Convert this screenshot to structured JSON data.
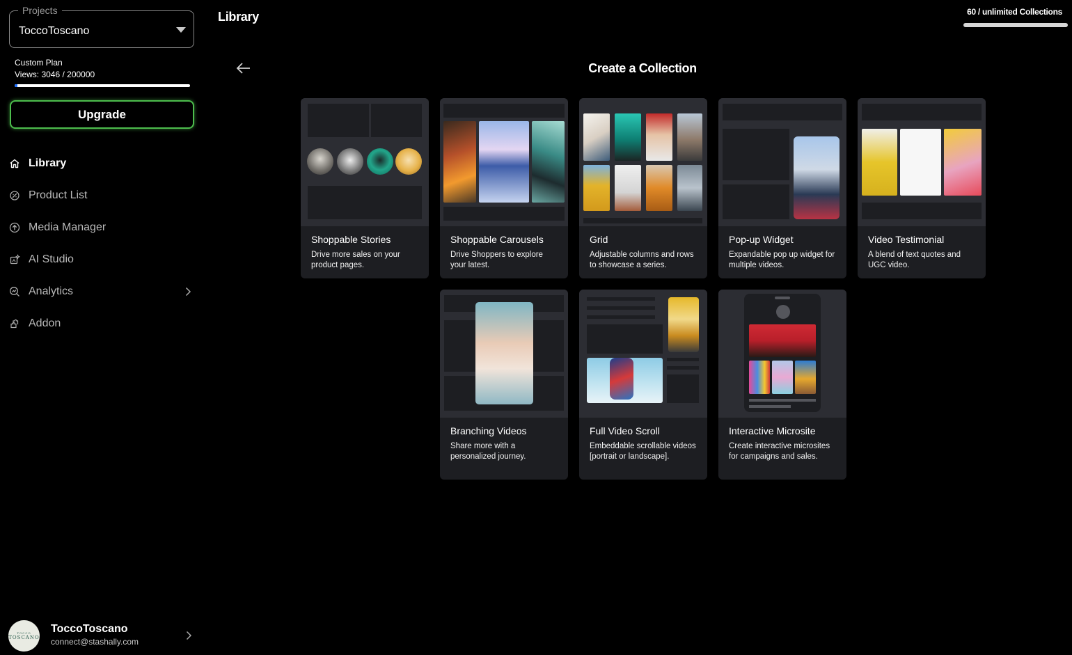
{
  "sidebar": {
    "project_legend": "Projects",
    "project_value": "ToccoToscano",
    "plan_name": "Custom Plan",
    "views_text": "Views: 3046 / 200000",
    "views_fraction": 0.015,
    "upgrade_label": "Upgrade",
    "nav": [
      {
        "label": "Library",
        "icon": "home-icon",
        "active": true
      },
      {
        "label": "Product List",
        "icon": "tag-icon"
      },
      {
        "label": "Media Manager",
        "icon": "upload-icon"
      },
      {
        "label": "AI Studio",
        "icon": "ai-sparkle-icon"
      },
      {
        "label": "Analytics",
        "icon": "analytics-icon"
      },
      {
        "label": "Addon",
        "icon": "puzzle-icon"
      }
    ],
    "user": {
      "name": "ToccoToscano",
      "email": "connect@stashally.com",
      "avatar_small": "TOCCO",
      "avatar_big": "TOSCANO"
    }
  },
  "header": {
    "title": "Library",
    "collections_text": "60 / unlimited Collections",
    "collections_fraction": 1
  },
  "main": {
    "title": "Create a Collection",
    "cards": [
      {
        "title": "Shoppable Stories",
        "desc": "Drive more sales on your product pages."
      },
      {
        "title": "Shoppable Carousels",
        "desc": "Drive Shoppers to explore your latest."
      },
      {
        "title": "Grid",
        "desc": "Adjustable columns and rows to showcase a series."
      },
      {
        "title": "Pop-up Widget",
        "desc": "Expandable pop up widget for multiple videos."
      },
      {
        "title": "Video Testimonial",
        "desc": "A blend of text quotes and UGC video."
      },
      {
        "title": "Branching Videos",
        "desc": "Share more with a personalized journey."
      },
      {
        "title": "Full Video Scroll",
        "desc": "Embeddable scrollable videos [portrait or landscape]."
      },
      {
        "title": "Interactive Microsite",
        "desc": "Create interactive microsites for campaigns and sales."
      }
    ]
  },
  "colors": {
    "accent_green": "#4dbd4d",
    "progress_blue": "#1e6fff",
    "card_bg": "#1d1e22",
    "thumb_bg": "#2c2d33"
  }
}
